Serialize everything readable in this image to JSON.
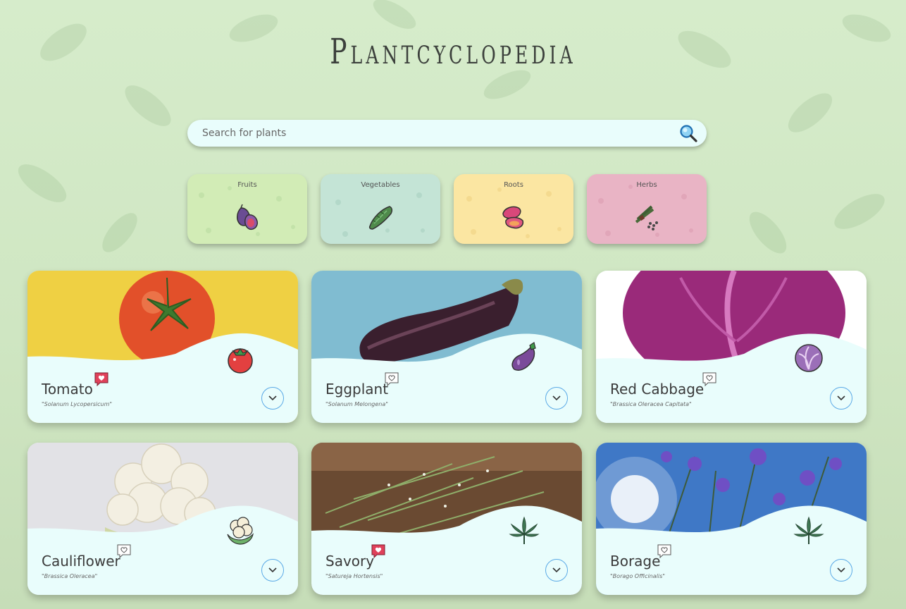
{
  "app_title": "Plantcyclopedia",
  "search": {
    "placeholder": "Search for plants",
    "icon": "magnifier-icon"
  },
  "categories": [
    {
      "label": "Fruits",
      "icon": "fig-icon",
      "color": "#d2ecb6"
    },
    {
      "label": "Vegetables",
      "icon": "cucumber-icon",
      "color": "#c4e4d6"
    },
    {
      "label": "Roots",
      "icon": "sweet-potato-icon",
      "color": "#fbe6a2"
    },
    {
      "label": "Herbs",
      "icon": "herb-bundle-icon",
      "color": "#e9b4c5"
    }
  ],
  "plants": [
    {
      "name": "Tomato",
      "scientific": "\"Solanum Lycopersicum\"",
      "favorited": true,
      "icon": "tomato-icon",
      "photo_color": "#efd043"
    },
    {
      "name": "Eggplant",
      "scientific": "\"Solanum Melongena\"",
      "favorited": false,
      "icon": "eggplant-icon",
      "photo_color": "#80bcd1"
    },
    {
      "name": "Red Cabbage",
      "scientific": "\"Brassica Oleracea Capitata\"",
      "favorited": false,
      "icon": "cabbage-icon",
      "photo_color": "#ffffff"
    },
    {
      "name": "Cauliflower",
      "scientific": "\"Brassica Oleracea\"",
      "favorited": false,
      "icon": "cauliflower-icon",
      "photo_color": "#e2e2e6"
    },
    {
      "name": "Savory",
      "scientific": "\"Satureja Hortensis\"",
      "favorited": true,
      "icon": "herb-leaf-icon",
      "photo_color": "#6a4a32"
    },
    {
      "name": "Borage",
      "scientific": "\"Borago Officinalis\"",
      "favorited": false,
      "icon": "herb-leaf-icon",
      "photo_color": "#3f78c6"
    }
  ],
  "colors": {
    "favorite": "#e0415a",
    "favorite_outline": "#555555",
    "expand_ring": "#5aa9e6",
    "card_bg": "#e9fdfc"
  }
}
